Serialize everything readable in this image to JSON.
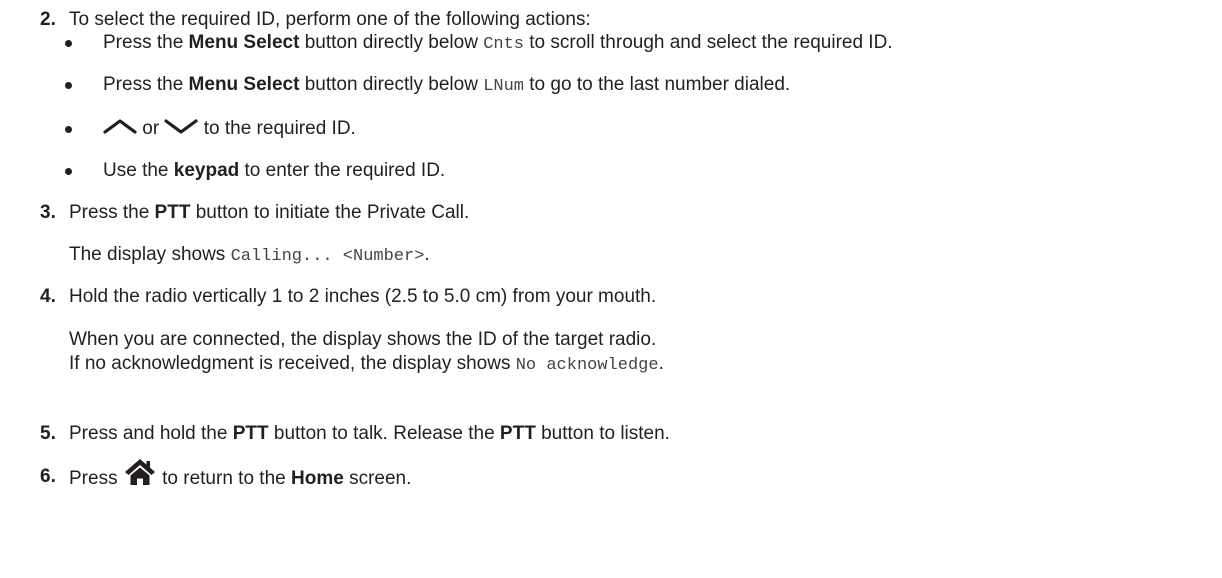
{
  "steps": [
    {
      "number": "2.",
      "text": "To select the required ID, perform one of the following actions:"
    },
    {
      "number": "3.",
      "pre": "Press the ",
      "bold": "PTT",
      "post": " button to initiate the Private Call."
    },
    {
      "number": "4.",
      "text": "Hold the radio vertically 1 to 2 inches (2.5 to 5.0 cm) from your mouth."
    },
    {
      "number": "5.",
      "pre": "Press and hold the ",
      "bold1": "PTT",
      "mid": " button to talk. Release the ",
      "bold2": "PTT",
      "post": " button to listen."
    },
    {
      "number": "6.",
      "pre": "Press ",
      "icon": "home-icon",
      "mid": " to return to the ",
      "bold": "Home",
      "post": " screen."
    }
  ],
  "bullets": [
    {
      "pre": "Press the ",
      "bold": "Menu Select",
      "mid": " button directly below ",
      "code": "Cnts",
      "post": " to scroll through and select the required ID."
    },
    {
      "pre": "Press the ",
      "bold": "Menu Select",
      "mid": " button directly below ",
      "code": "LNum",
      "post": " to go to the last number dialed."
    },
    {
      "icon1": "chevron-up-icon",
      "mid": " or ",
      "icon2": "chevron-down-icon",
      "post": " to the required ID."
    },
    {
      "pre": "Use the ",
      "bold": "keypad",
      "post": " to enter the required ID."
    }
  ],
  "step3_result": {
    "pre": "The display shows ",
    "code": "Calling... <Number>",
    "post": "."
  },
  "step4_result": {
    "line1": "When you are connected, the display shows the ID of the target radio.",
    "line2_pre": "If no acknowledgment is received, the display shows ",
    "line2_code": "No acknowledge",
    "line2_post": "."
  }
}
